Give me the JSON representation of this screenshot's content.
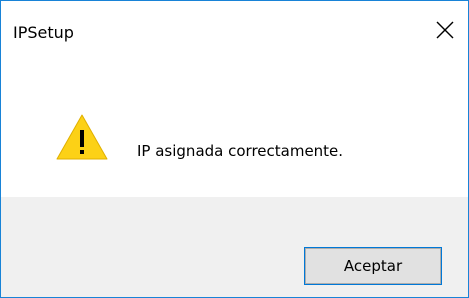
{
  "window": {
    "title": "IPSetup",
    "accent_color": "#1883d7"
  },
  "titlebar": {
    "close_icon": "close-icon"
  },
  "content": {
    "icon": "warning-icon",
    "icon_color": "#fcd116",
    "message": "IP asignada correctamente."
  },
  "footer": {
    "ok_label": "Aceptar"
  }
}
